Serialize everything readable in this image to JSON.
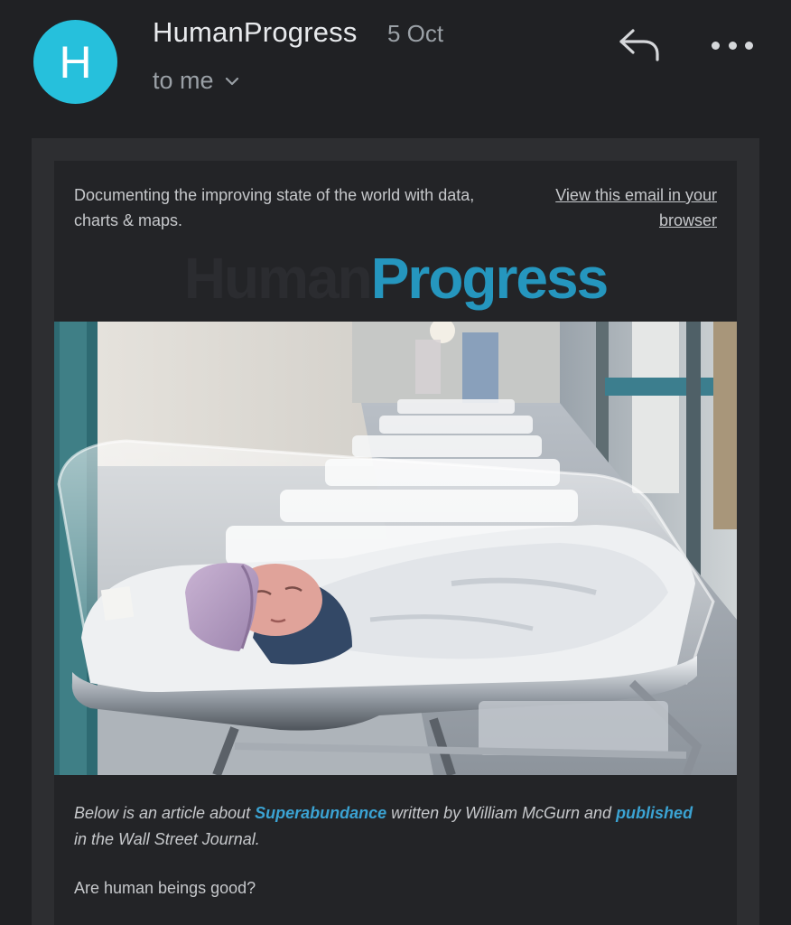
{
  "header": {
    "avatar_letter": "H",
    "sender": "HumanProgress",
    "date": "5 Oct",
    "recipient": "to me",
    "reply_icon": "reply-icon",
    "more_icon": "more-icon",
    "avatar_color": "#26c0dc"
  },
  "email": {
    "tagline": "Documenting the improving state of the world with data, charts & maps.",
    "view_in_browser": "View this email in your browser",
    "logo_part1": "Human",
    "logo_part2": "Progress",
    "logo_color": "#2596be",
    "intro_1": "Below is an article about ",
    "link_superabundance": "Superabundance",
    "intro_2": " written by William McGurn and ",
    "link_published": "published",
    "intro_3": " in the Wall Street Journal.",
    "question": "Are human beings good?"
  }
}
